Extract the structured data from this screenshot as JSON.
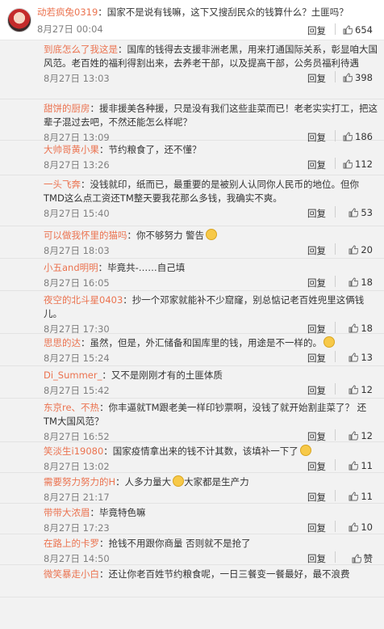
{
  "top": {
    "user": "动若疯兔0319",
    "text": "：国家不是说有钱嘛，这下又搜刮民众的钱算什么？土匪吗？",
    "time": "8月27日 00:04",
    "reply": "回复",
    "likes": "654"
  },
  "replies": [
    {
      "user": "到底怎么了我这是",
      "text": "：国库的钱得去支援非洲老黑，用来打通国际关系，彰显咱大国风范。老百姓的福利得割出来，去养老干部，以及提高干部，公务员福利待遇",
      "time": "8月27日 13:03",
      "reply": "回复",
      "likes": "398"
    },
    {
      "user": "甜饼的厨房",
      "text": "：援非援美各种援，只是没有我们这些韭菜而已！老老实实打工，把这辈子混过去吧，不然还能怎么样呢？",
      "time": "8月27日 13:09",
      "reply": "回复",
      "likes": "186"
    },
    {
      "user": "大帅哥黄小果",
      "text": "：节约粮食了，还不懂？",
      "time": "8月27日 13:26",
      "reply": "回复",
      "likes": "112"
    },
    {
      "user": "一头飞奔",
      "text": "：没钱就印，纸而已，最重要的是被别人认同你人民币的地位。但你TMD这么点工资还TM整天要我花那么多钱，我确实不爽。",
      "time": "8月27日 15:40",
      "reply": "回复",
      "likes": "53"
    },
    {
      "user": "可以做我怀里的猫吗",
      "text": "：你不够努力 警告",
      "emoji": true,
      "time": "8月27日 18:03",
      "reply": "回复",
      "likes": "20"
    },
    {
      "user": "小五and明明",
      "text": "：毕竟共-……自己填",
      "time": "8月27日 16:05",
      "reply": "回复",
      "likes": "18"
    },
    {
      "user": "夜空的北斗星0403",
      "text": "：抄一个邓家就能补不少窟窿，别总惦记老百姓兜里这俩钱儿。",
      "time": "8月27日 17:30",
      "reply": "回复",
      "likes": "18"
    },
    {
      "user": "思思的达",
      "text": "：虽然，但是，外汇储备和国库里的钱，用途是不一样的。",
      "emoji": true,
      "time": "8月27日 15:24",
      "reply": "回复",
      "likes": "13"
    },
    {
      "user": "Di_Summer_",
      "text": "：又不是刚刚才有的土匪体质",
      "time": "8月27日 15:42",
      "reply": "回复",
      "likes": "12"
    },
    {
      "user": "东京re、不热",
      "text": "：你丰逼就TM跟老美一样印钞票啊，没钱了就开始割韭菜了？ 还TM大国风范？",
      "time": "8月27日 16:52",
      "reply": "回复",
      "likes": "12"
    },
    {
      "user": "笑淡生i19080",
      "text": "：国家疫情拿出来的钱不计其数，该填补一下了",
      "emoji": true,
      "time": "8月27日 13:02",
      "reply": "回复",
      "likes": "11"
    },
    {
      "user": "需要努力努力的H",
      "text": "：人多力量大",
      "emoji": true,
      "text2": "大家都是生产力",
      "time": "8月27日 21:17",
      "reply": "回复",
      "likes": "11"
    },
    {
      "user": "带带大浓眉",
      "text": "：毕竟特色嘛",
      "time": "8月27日 17:23",
      "reply": "回复",
      "likes": "10"
    },
    {
      "user": "在路上的卡罗",
      "text": "：抢钱不用跟你商量 否则就不是抢了",
      "time": "8月27日 14:50",
      "reply": "回复",
      "likes": "赞"
    },
    {
      "user": "微笑暴走小白",
      "text": "：还让你老百姓节约粮食呢，一日三餐变一餐最好，最不浪费",
      "time": "",
      "reply": "",
      "likes": ""
    }
  ],
  "colors": {
    "username": "#eb7350",
    "time": "#808080",
    "background": "#f2f2f2"
  }
}
